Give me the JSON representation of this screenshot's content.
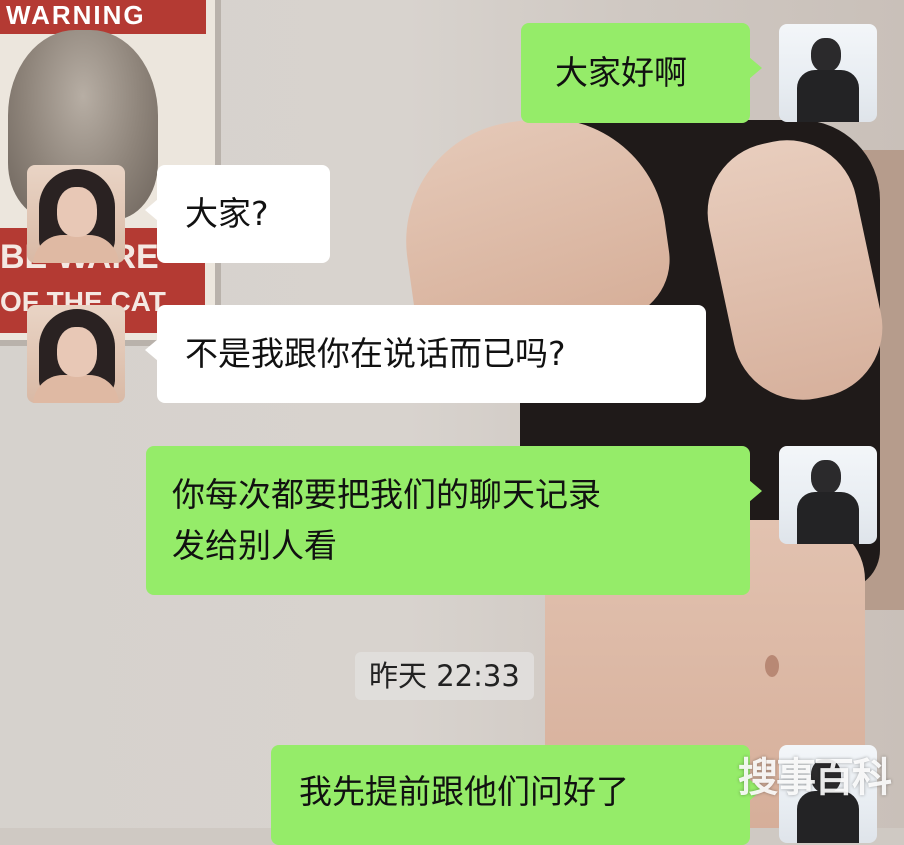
{
  "background": {
    "poster_top_text": "WARNING",
    "poster_bottom_line1": "BE WARE",
    "poster_bottom_line2": "OF THE CAT"
  },
  "messages": [
    {
      "side": "right",
      "text": [
        "大家好啊"
      ]
    },
    {
      "side": "left",
      "text": [
        "大家?"
      ]
    },
    {
      "side": "left",
      "text": [
        "不是我跟你在说话而已吗?"
      ]
    },
    {
      "side": "right",
      "text": [
        "你每次都要把我们的聊天记录",
        "发给别人看"
      ]
    },
    {
      "side": "right",
      "text": [
        "我先提前跟他们问好了"
      ]
    }
  ],
  "timestamp": "昨天 22:33",
  "watermark": "搜事百科",
  "colors": {
    "green_bubble": "#95ec69",
    "white_bubble": "#ffffff"
  },
  "icons": {
    "my_avatar": "avatar-man-icon",
    "her_avatar": "avatar-woman-icon"
  }
}
